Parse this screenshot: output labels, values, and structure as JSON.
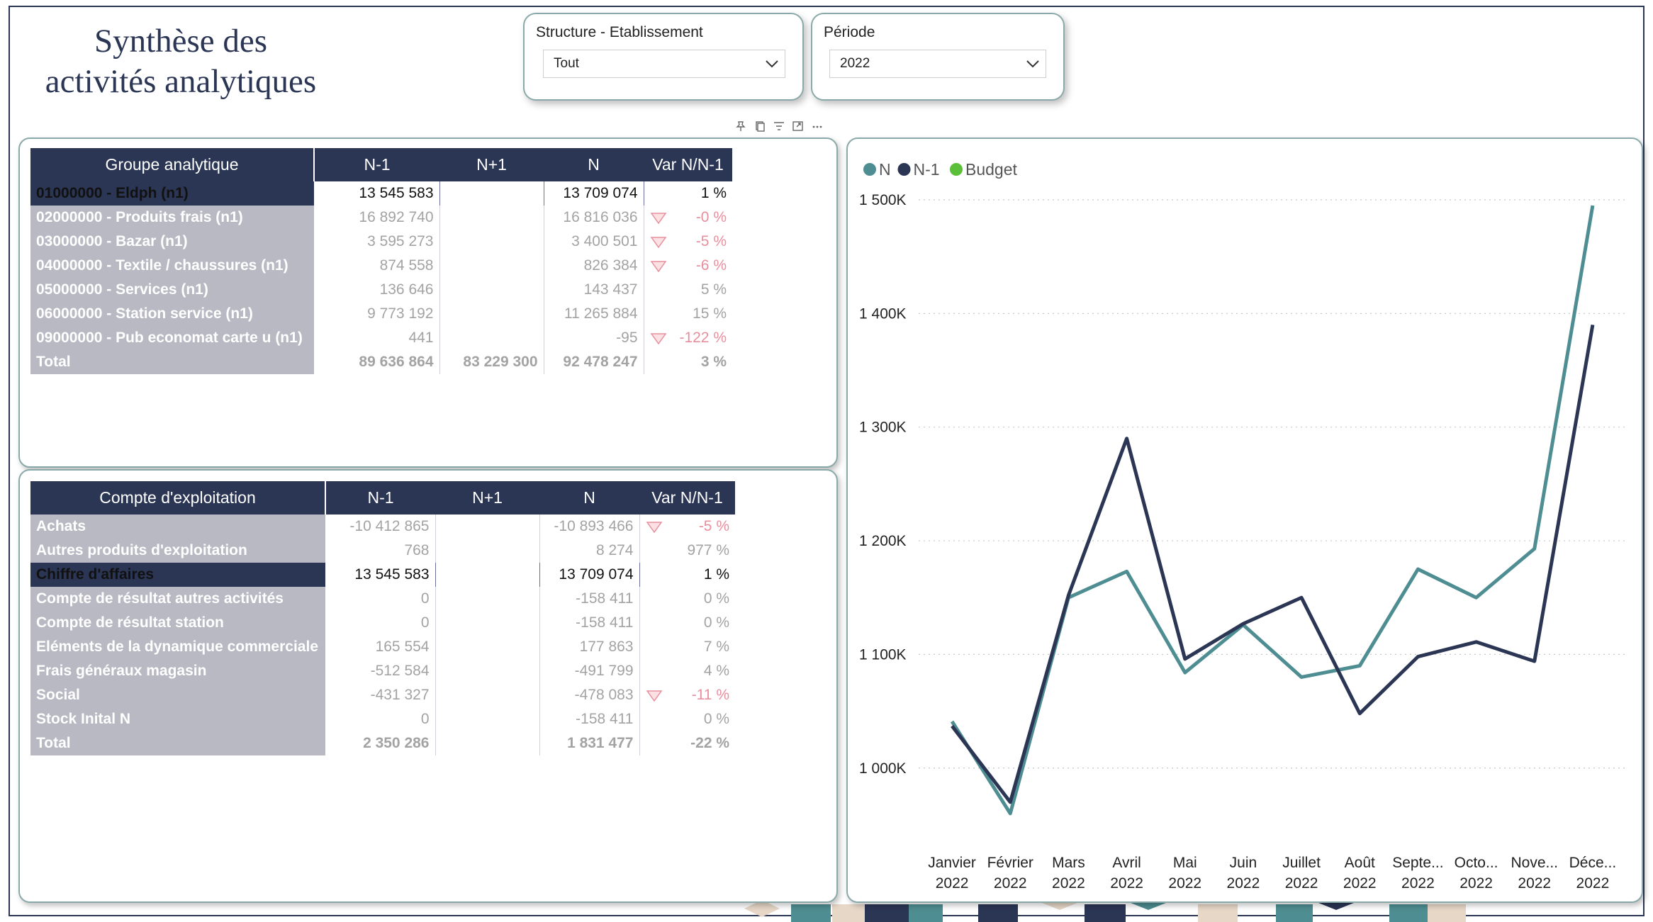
{
  "header": {
    "title_line1": "Synthèse des",
    "title_line2": "activités analytiques"
  },
  "slicers": [
    {
      "label": "Structure - Etablissement",
      "value": "Tout"
    },
    {
      "label": "Période",
      "value": "2022"
    }
  ],
  "table_groupe": {
    "columns": [
      "Groupe analytique",
      "N-1",
      "N+1",
      "N",
      "Var N/N-1"
    ],
    "rows": [
      {
        "label": "01000000 - Eldph (n1)",
        "n_1": "13 545 583",
        "n_plus_1": "",
        "n": "13 709 074",
        "var": "1 %",
        "down": false,
        "selected": true
      },
      {
        "label": "02000000 - Produits frais (n1)",
        "n_1": "16 892 740",
        "n_plus_1": "",
        "n": "16 816 036",
        "var": "-0 %",
        "down": true
      },
      {
        "label": "03000000 - Bazar (n1)",
        "n_1": "3 595 273",
        "n_plus_1": "",
        "n": "3 400 501",
        "var": "-5 %",
        "down": true
      },
      {
        "label": "04000000 - Textile / chaussures (n1)",
        "n_1": "874 558",
        "n_plus_1": "",
        "n": "826 384",
        "var": "-6 %",
        "down": true
      },
      {
        "label": "05000000 - Services (n1)",
        "n_1": "136 646",
        "n_plus_1": "",
        "n": "143 437",
        "var": "5 %",
        "down": false
      },
      {
        "label": "06000000 - Station service (n1)",
        "n_1": "9 773 192",
        "n_plus_1": "",
        "n": "11 265 884",
        "var": "15 %",
        "down": false
      },
      {
        "label": "09000000 - Pub economat carte u (n1)",
        "n_1": "441",
        "n_plus_1": "",
        "n": "-95",
        "var": "-122 %",
        "down": true
      }
    ],
    "total": {
      "label": "Total",
      "n_1": "89 636 864",
      "n_plus_1": "83 229 300",
      "n": "92 478 247",
      "var": "3 %"
    }
  },
  "table_compte": {
    "columns": [
      "Compte d'exploitation",
      "N-1",
      "N+1",
      "N",
      "Var N/N-1"
    ],
    "rows": [
      {
        "label": "Achats",
        "n_1": "-10 412 865",
        "n_plus_1": "",
        "n": "-10 893 466",
        "var": "-5 %",
        "down": true
      },
      {
        "label": "Autres produits d'exploitation",
        "n_1": "768",
        "n_plus_1": "",
        "n": "8 274",
        "var": "977 %",
        "down": false
      },
      {
        "label": "Chiffre d'affaires",
        "n_1": "13 545 583",
        "n_plus_1": "",
        "n": "13 709 074",
        "var": "1 %",
        "down": false,
        "selected": true
      },
      {
        "label": "Compte de résultat autres activités",
        "n_1": "0",
        "n_plus_1": "",
        "n": "-158 411",
        "var": "0 %",
        "down": false
      },
      {
        "label": "Compte de résultat station",
        "n_1": "0",
        "n_plus_1": "",
        "n": "-158 411",
        "var": "0 %",
        "down": false
      },
      {
        "label": "Eléments de la dynamique commerciale",
        "n_1": "165 554",
        "n_plus_1": "",
        "n": "177 863",
        "var": "7 %",
        "down": false
      },
      {
        "label": "Frais généraux magasin",
        "n_1": "-512 584",
        "n_plus_1": "",
        "n": "-491 799",
        "var": "4 %",
        "down": false
      },
      {
        "label": "Social",
        "n_1": "-431 327",
        "n_plus_1": "",
        "n": "-478 083",
        "var": "-11 %",
        "down": true
      },
      {
        "label": "Stock Inital N",
        "n_1": "0",
        "n_plus_1": "",
        "n": "-158 411",
        "var": "0 %",
        "down": false
      }
    ],
    "total": {
      "label": "Total",
      "n_1": "2 350 286",
      "n_plus_1": "",
      "n": "1 831 477",
      "var": "-22 %"
    }
  },
  "colors": {
    "navy": "#2b3554",
    "teal": "#4e8d91",
    "budget": "#5cbf3a",
    "label_bg": "#b9b9c4",
    "negative": "#e88f9d"
  },
  "chart_data": {
    "type": "line",
    "legend": [
      "N",
      "N-1",
      "Budget"
    ],
    "legend_position": "top-left",
    "categories": [
      [
        "Janvier",
        "2022"
      ],
      [
        "Février",
        "2022"
      ],
      [
        "Mars",
        "2022"
      ],
      [
        "Avril",
        "2022"
      ],
      [
        "Mai",
        "2022"
      ],
      [
        "Juin",
        "2022"
      ],
      [
        "Juillet",
        "2022"
      ],
      [
        "Août",
        "2022"
      ],
      [
        "Septe...",
        "2022"
      ],
      [
        "Octo...",
        "2022"
      ],
      [
        "Nove...",
        "2022"
      ],
      [
        "Déce...",
        "2022"
      ]
    ],
    "series": [
      {
        "name": "N",
        "color": "#4e8d91",
        "values": [
          1041000,
          960000,
          1150000,
          1173000,
          1084000,
          1126000,
          1080000,
          1090000,
          1175000,
          1150000,
          1193000,
          1495000
        ]
      },
      {
        "name": "N-1",
        "color": "#2b3554",
        "values": [
          1037000,
          970000,
          1152000,
          1290000,
          1096000,
          1127000,
          1150000,
          1048000,
          1098000,
          1111000,
          1094000,
          1390000
        ]
      },
      {
        "name": "Budget",
        "color": "#5cbf3a",
        "values": []
      }
    ],
    "yticks": [
      "1 500K",
      "1 400K",
      "1 300K",
      "1 200K",
      "1 100K",
      "1 000K"
    ],
    "ytick_values": [
      1500000,
      1400000,
      1300000,
      1200000,
      1100000,
      1000000
    ],
    "ylim": [
      930000,
      1500000
    ],
    "grid": true
  }
}
